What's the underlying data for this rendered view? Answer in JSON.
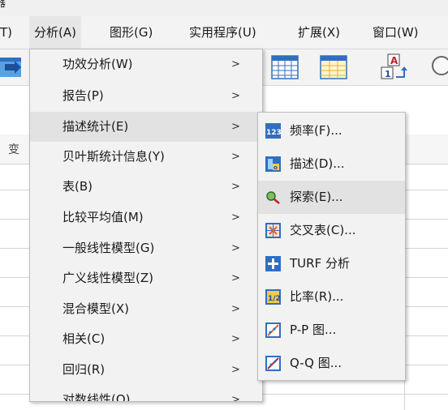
{
  "window": {
    "title_fragment": "器"
  },
  "menubar": {
    "items": [
      {
        "label": "T)"
      },
      {
        "label": "分析(A)",
        "active": true
      },
      {
        "label": "图形(G)"
      },
      {
        "label": "实用程序(U)"
      },
      {
        "label": "扩展(X)"
      },
      {
        "label": "窗口(W)"
      }
    ]
  },
  "toolbar": {
    "icons": [
      "goto-case-icon",
      "data-grid-icon",
      "grid-table-icon",
      "value-labels-icon",
      "search-icon"
    ]
  },
  "sheet": {
    "column_header_fragment": "变"
  },
  "analyze_menu": {
    "items": [
      {
        "label": "功效分析(W)"
      },
      {
        "label": "报告(P)"
      },
      {
        "label": "描述统计(E)",
        "highlighted": true
      },
      {
        "label": "贝叶斯统计信息(Y)"
      },
      {
        "label": "表(B)"
      },
      {
        "label": "比较平均值(M)"
      },
      {
        "label": "一般线性模型(G)"
      },
      {
        "label": "广义线性模型(Z)"
      },
      {
        "label": "混合模型(X)"
      },
      {
        "label": "相关(C)"
      },
      {
        "label": "回归(R)"
      },
      {
        "label": "对数线性(O)"
      }
    ],
    "arrow": ">"
  },
  "descriptive_submenu": {
    "items": [
      {
        "label": "频率(F)...",
        "icon": "frequencies-icon",
        "icon_text": "123",
        "icon_color": "#2f6fc2"
      },
      {
        "label": "描述(D)...",
        "icon": "descriptives-icon",
        "icon_text": "",
        "icon_color": "#2f6fc2"
      },
      {
        "label": "探索(E)...",
        "icon": "explore-icon",
        "icon_text": "",
        "icon_color": "#3a8a3a",
        "highlighted": true
      },
      {
        "label": "交叉表(C)...",
        "icon": "crosstabs-icon",
        "icon_text": "",
        "icon_color": "#2f6fc2"
      },
      {
        "label": "TURF 分析",
        "icon": "turf-icon",
        "icon_text": "",
        "icon_color": "#2f6fc2"
      },
      {
        "label": "比率(R)...",
        "icon": "ratio-icon",
        "icon_text": "1/2",
        "icon_color": "#2f6fc2"
      },
      {
        "label": "P-P 图...",
        "icon": "pp-plot-icon",
        "icon_text": "",
        "icon_color": "#2f6fc2"
      },
      {
        "label": "Q-Q 图...",
        "icon": "qq-plot-icon",
        "icon_text": "",
        "icon_color": "#2f6fc2"
      }
    ]
  }
}
